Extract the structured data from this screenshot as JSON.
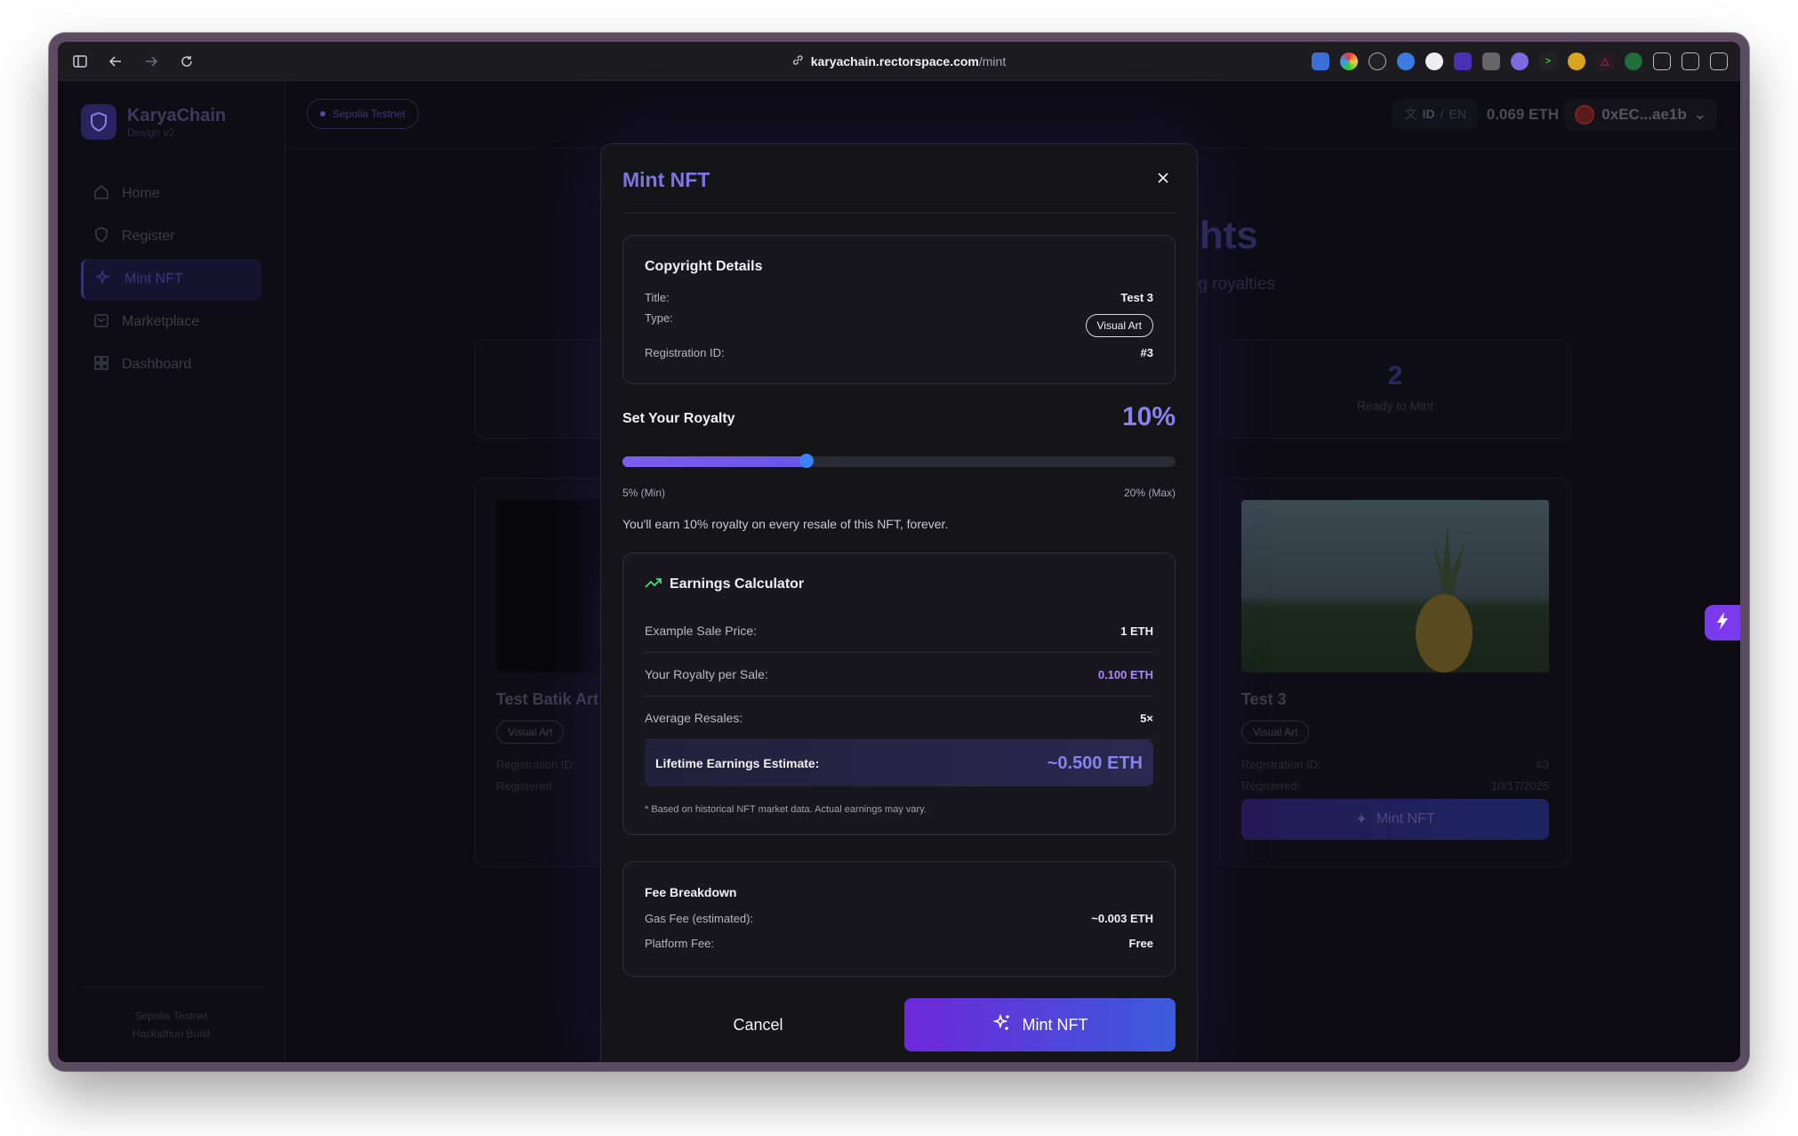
{
  "browser": {
    "url_host": "karyachain.rectorspace.com",
    "url_path": "/mint"
  },
  "sidebar": {
    "brand_name": "KaryaChain",
    "brand_sub": "Design v2",
    "items": [
      {
        "label": "Home",
        "icon": "home-icon"
      },
      {
        "label": "Register",
        "icon": "shield-icon"
      },
      {
        "label": "Mint NFT",
        "icon": "sparkles-icon"
      },
      {
        "label": "Marketplace",
        "icon": "bag-icon"
      },
      {
        "label": "Dashboard",
        "icon": "grid-icon"
      }
    ],
    "footer_line1": "Sepolia Testnet",
    "footer_line2": "Hackathon Build"
  },
  "topbar": {
    "network": "Sepolia Testnet",
    "lang_active": "ID",
    "lang_sep": "/",
    "lang_other": "EN",
    "balance": "0.069 ETH",
    "wallet": "0xEC...ae1b"
  },
  "background": {
    "hero_title_fragment": "ghts",
    "hero_sub_fragment": "ning royalties",
    "stat_right_value": "2",
    "stat_right_label": "Ready to Mint",
    "card_left": {
      "title": "Test Batik Art",
      "tag": "Visual Art",
      "reg_label": "Registration ID:",
      "date_label": "Registered:"
    },
    "card_right": {
      "title": "Test 3",
      "tag": "Visual Art",
      "reg_label": "Registration ID:",
      "reg_value": "#3",
      "date_label": "Registered:",
      "date_value": "10/17/2025",
      "button": "Mint NFT"
    }
  },
  "modal": {
    "title": "Mint NFT",
    "copyright": {
      "heading": "Copyright Details",
      "title_label": "Title:",
      "title_value": "Test 3",
      "type_label": "Type:",
      "type_value": "Visual Art",
      "reg_label": "Registration ID:",
      "reg_value": "#3"
    },
    "royalty": {
      "label": "Set Your Royalty",
      "value_text": "10%",
      "value": 10,
      "min": 5,
      "max": 20,
      "min_label": "5% (Min)",
      "max_label": "20% (Max)",
      "note": "You'll earn 10% royalty on every resale of this NFT, forever."
    },
    "calculator": {
      "heading": "Earnings Calculator",
      "rows": [
        {
          "label": "Example Sale Price:",
          "value": "1 ETH"
        },
        {
          "label": "Your Royalty per Sale:",
          "value": "0.100 ETH"
        },
        {
          "label": "Average Resales:",
          "value": "5×"
        }
      ],
      "lifetime_label": "Lifetime Earnings Estimate:",
      "lifetime_value": "~0.500 ETH",
      "note": "* Based on historical NFT market data. Actual earnings may vary."
    },
    "fees": {
      "heading": "Fee Breakdown",
      "gas_label": "Gas Fee (estimated):",
      "gas_value": "~0.003 ETH",
      "platform_label": "Platform Fee:",
      "platform_value": "Free"
    },
    "cancel": "Cancel",
    "mint": "Mint NFT"
  },
  "colors": {
    "accent": "#7f73e6",
    "mint_gradient_start": "#6d28d9",
    "mint_gradient_end": "#3b5bdb",
    "fab": "#7c3aed"
  }
}
